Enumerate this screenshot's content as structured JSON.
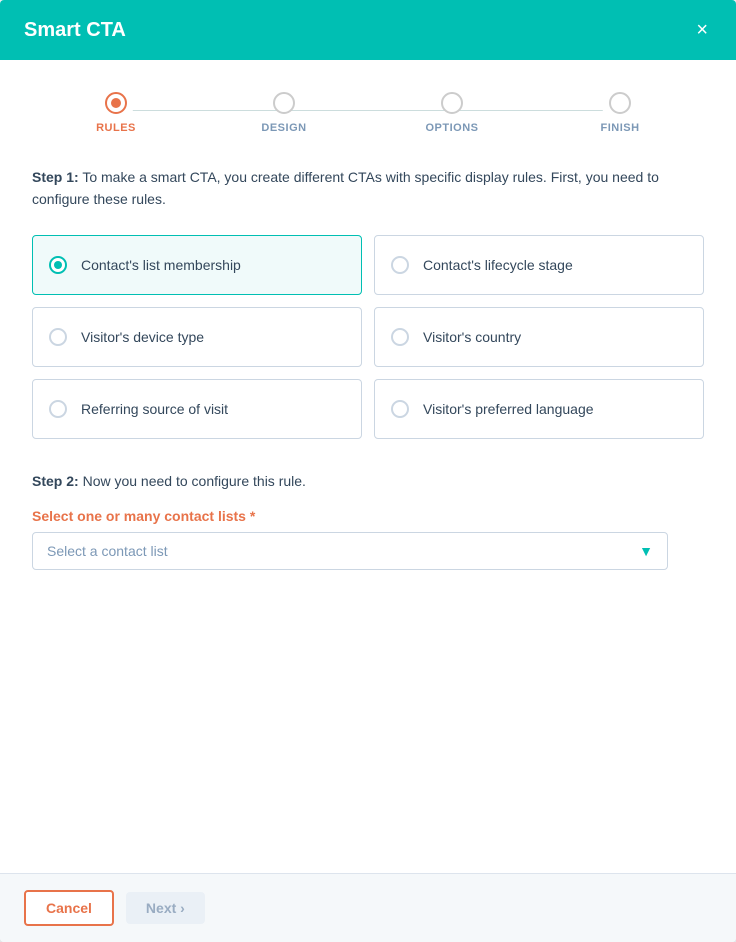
{
  "modal": {
    "title": "Smart CTA",
    "close_label": "×"
  },
  "stepper": {
    "steps": [
      {
        "label": "RULES",
        "active": true
      },
      {
        "label": "DESIGN",
        "active": false
      },
      {
        "label": "OPTIONS",
        "active": false
      },
      {
        "label": "FINISH",
        "active": false
      }
    ]
  },
  "step1": {
    "description_bold": "Step 1:",
    "description_text": " To make a smart CTA, you create different CTAs with specific display rules. First, you need to configure these rules."
  },
  "options": [
    {
      "id": "list-membership",
      "label": "Contact's list membership",
      "selected": true
    },
    {
      "id": "lifecycle-stage",
      "label": "Contact's lifecycle stage",
      "selected": false
    },
    {
      "id": "device-type",
      "label": "Visitor's device type",
      "selected": false
    },
    {
      "id": "country",
      "label": "Visitor's country",
      "selected": false
    },
    {
      "id": "referring-source",
      "label": "Referring source of visit",
      "selected": false
    },
    {
      "id": "preferred-language",
      "label": "Visitor's preferred language",
      "selected": false
    }
  ],
  "step2": {
    "description_bold": "Step 2:",
    "description_text": " Now you need to configure this rule."
  },
  "contact_list_field": {
    "label": "Select one or many contact lists",
    "required_marker": " *",
    "placeholder": "Select a contact list"
  },
  "footer": {
    "cancel_label": "Cancel",
    "next_label": "Next ›"
  }
}
